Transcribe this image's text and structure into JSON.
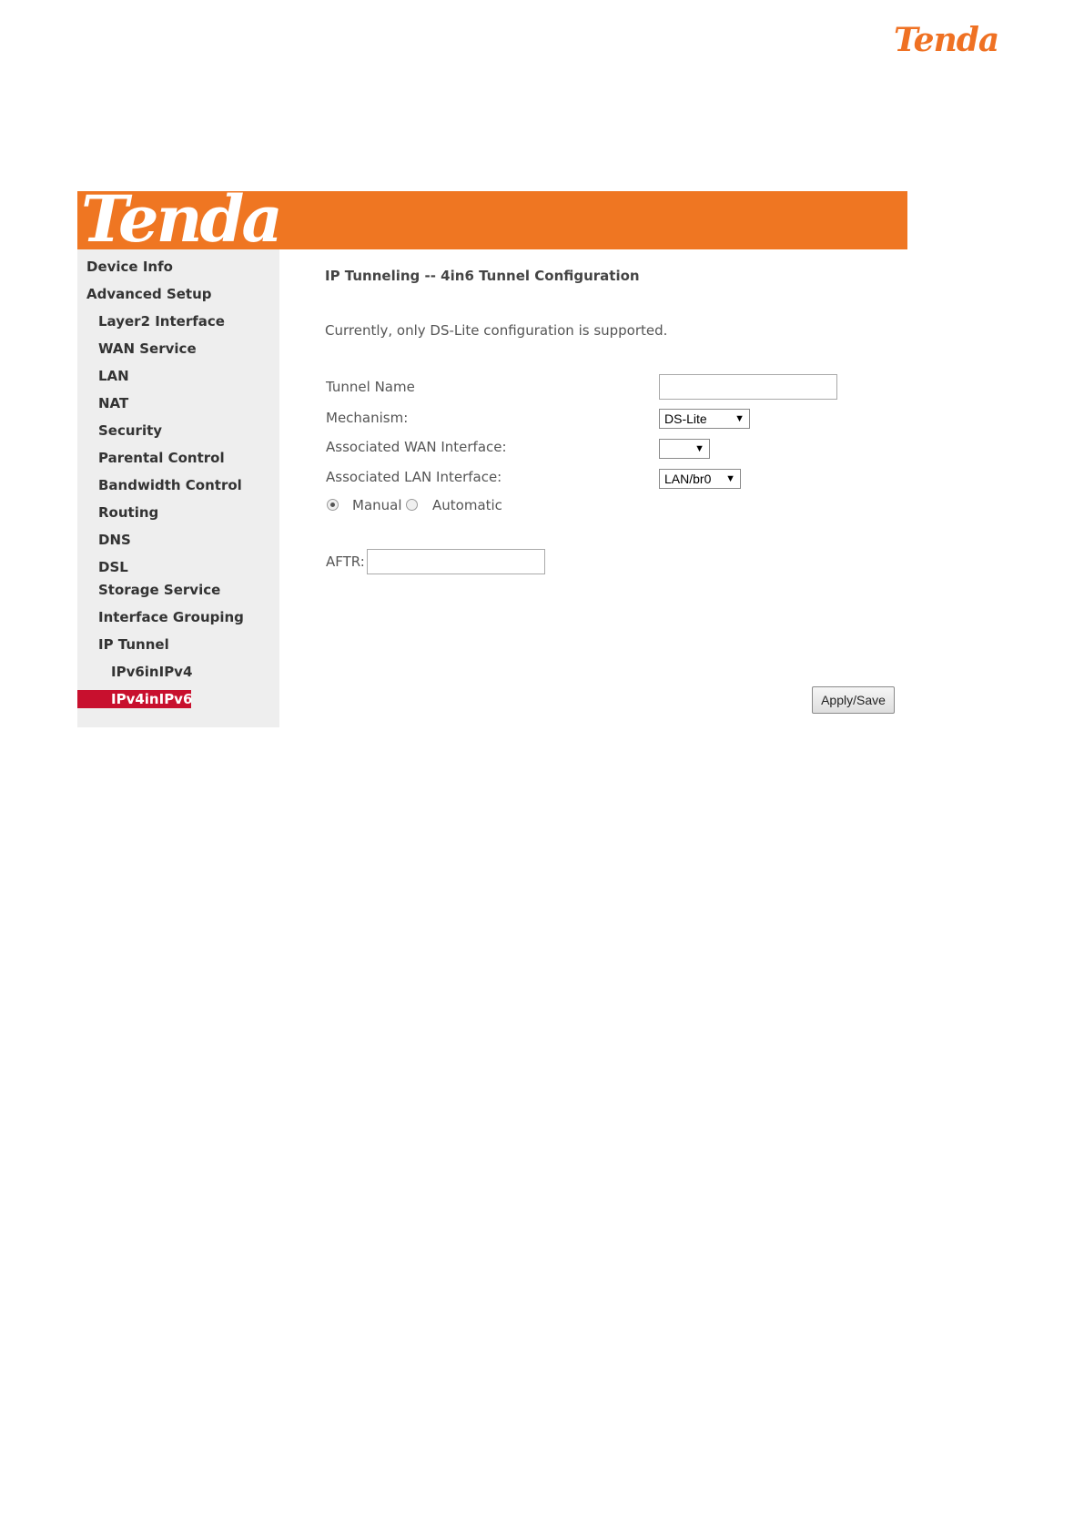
{
  "brand": {
    "page_logo": "Tenda",
    "banner_logo": "Tenda",
    "accent_color": "#ef7622",
    "active_color": "#c8102e"
  },
  "sidebar": {
    "items": [
      {
        "label": "Device Info",
        "level": 0
      },
      {
        "label": "Advanced Setup",
        "level": 0
      },
      {
        "label": "Layer2 Interface",
        "level": 1
      },
      {
        "label": "WAN Service",
        "level": 1
      },
      {
        "label": "LAN",
        "level": 1
      },
      {
        "label": "NAT",
        "level": 1
      },
      {
        "label": "Security",
        "level": 1
      },
      {
        "label": "Parental Control",
        "level": 1
      },
      {
        "label": "Bandwidth Control",
        "level": 1
      },
      {
        "label": "Routing",
        "level": 1
      },
      {
        "label": "DNS",
        "level": 1
      },
      {
        "label": "DSL",
        "level": 1
      },
      {
        "label": "Storage Service",
        "level": 1
      },
      {
        "label": "Interface Grouping",
        "level": 1
      },
      {
        "label": "IP Tunnel",
        "level": 1
      },
      {
        "label": "IPv6inIPv4",
        "level": 2
      },
      {
        "label": "IPv4inIPv6",
        "level": 2,
        "active": true
      }
    ]
  },
  "main": {
    "title": "IP Tunneling -- 4in6 Tunnel Configuration",
    "note": "Currently, only DS-Lite configuration is supported.",
    "tunnel_name": {
      "label": "Tunnel Name",
      "value": ""
    },
    "mechanism": {
      "label": "Mechanism:",
      "value": "DS-Lite"
    },
    "wan_interface": {
      "label": "Associated WAN Interface:",
      "value": ""
    },
    "lan_interface": {
      "label": "Associated LAN Interface:",
      "value": "LAN/br0"
    },
    "mode": {
      "manual_label": "Manual",
      "automatic_label": "Automatic",
      "selected": "Manual"
    },
    "aftr": {
      "label": "AFTR:",
      "value": ""
    },
    "apply_label": "Apply/Save"
  }
}
